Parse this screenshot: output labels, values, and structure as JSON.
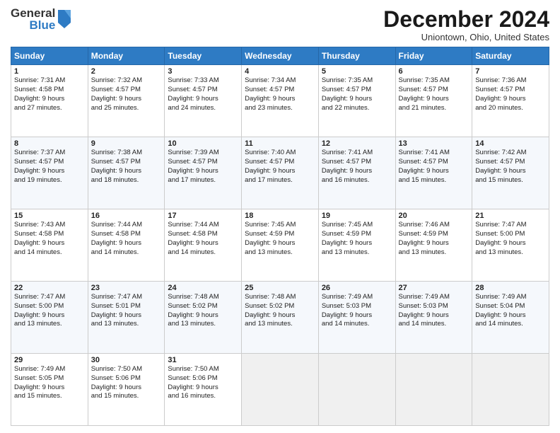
{
  "logo": {
    "general": "General",
    "blue": "Blue"
  },
  "title": "December 2024",
  "location": "Uniontown, Ohio, United States",
  "days_header": [
    "Sunday",
    "Monday",
    "Tuesday",
    "Wednesday",
    "Thursday",
    "Friday",
    "Saturday"
  ],
  "weeks": [
    [
      {
        "day": "1",
        "sunrise": "7:31 AM",
        "sunset": "4:58 PM",
        "daylight": "9 hours and 27 minutes."
      },
      {
        "day": "2",
        "sunrise": "7:32 AM",
        "sunset": "4:57 PM",
        "daylight": "9 hours and 25 minutes."
      },
      {
        "day": "3",
        "sunrise": "7:33 AM",
        "sunset": "4:57 PM",
        "daylight": "9 hours and 24 minutes."
      },
      {
        "day": "4",
        "sunrise": "7:34 AM",
        "sunset": "4:57 PM",
        "daylight": "9 hours and 23 minutes."
      },
      {
        "day": "5",
        "sunrise": "7:35 AM",
        "sunset": "4:57 PM",
        "daylight": "9 hours and 22 minutes."
      },
      {
        "day": "6",
        "sunrise": "7:35 AM",
        "sunset": "4:57 PM",
        "daylight": "9 hours and 21 minutes."
      },
      {
        "day": "7",
        "sunrise": "7:36 AM",
        "sunset": "4:57 PM",
        "daylight": "9 hours and 20 minutes."
      }
    ],
    [
      {
        "day": "8",
        "sunrise": "7:37 AM",
        "sunset": "4:57 PM",
        "daylight": "9 hours and 19 minutes."
      },
      {
        "day": "9",
        "sunrise": "7:38 AM",
        "sunset": "4:57 PM",
        "daylight": "9 hours and 18 minutes."
      },
      {
        "day": "10",
        "sunrise": "7:39 AM",
        "sunset": "4:57 PM",
        "daylight": "9 hours and 17 minutes."
      },
      {
        "day": "11",
        "sunrise": "7:40 AM",
        "sunset": "4:57 PM",
        "daylight": "9 hours and 17 minutes."
      },
      {
        "day": "12",
        "sunrise": "7:41 AM",
        "sunset": "4:57 PM",
        "daylight": "9 hours and 16 minutes."
      },
      {
        "day": "13",
        "sunrise": "7:41 AM",
        "sunset": "4:57 PM",
        "daylight": "9 hours and 15 minutes."
      },
      {
        "day": "14",
        "sunrise": "7:42 AM",
        "sunset": "4:57 PM",
        "daylight": "9 hours and 15 minutes."
      }
    ],
    [
      {
        "day": "15",
        "sunrise": "7:43 AM",
        "sunset": "4:58 PM",
        "daylight": "9 hours and 14 minutes."
      },
      {
        "day": "16",
        "sunrise": "7:44 AM",
        "sunset": "4:58 PM",
        "daylight": "9 hours and 14 minutes."
      },
      {
        "day": "17",
        "sunrise": "7:44 AM",
        "sunset": "4:58 PM",
        "daylight": "9 hours and 14 minutes."
      },
      {
        "day": "18",
        "sunrise": "7:45 AM",
        "sunset": "4:59 PM",
        "daylight": "9 hours and 13 minutes."
      },
      {
        "day": "19",
        "sunrise": "7:45 AM",
        "sunset": "4:59 PM",
        "daylight": "9 hours and 13 minutes."
      },
      {
        "day": "20",
        "sunrise": "7:46 AM",
        "sunset": "4:59 PM",
        "daylight": "9 hours and 13 minutes."
      },
      {
        "day": "21",
        "sunrise": "7:47 AM",
        "sunset": "5:00 PM",
        "daylight": "9 hours and 13 minutes."
      }
    ],
    [
      {
        "day": "22",
        "sunrise": "7:47 AM",
        "sunset": "5:00 PM",
        "daylight": "9 hours and 13 minutes."
      },
      {
        "day": "23",
        "sunrise": "7:47 AM",
        "sunset": "5:01 PM",
        "daylight": "9 hours and 13 minutes."
      },
      {
        "day": "24",
        "sunrise": "7:48 AM",
        "sunset": "5:02 PM",
        "daylight": "9 hours and 13 minutes."
      },
      {
        "day": "25",
        "sunrise": "7:48 AM",
        "sunset": "5:02 PM",
        "daylight": "9 hours and 13 minutes."
      },
      {
        "day": "26",
        "sunrise": "7:49 AM",
        "sunset": "5:03 PM",
        "daylight": "9 hours and 14 minutes."
      },
      {
        "day": "27",
        "sunrise": "7:49 AM",
        "sunset": "5:03 PM",
        "daylight": "9 hours and 14 minutes."
      },
      {
        "day": "28",
        "sunrise": "7:49 AM",
        "sunset": "5:04 PM",
        "daylight": "9 hours and 14 minutes."
      }
    ],
    [
      {
        "day": "29",
        "sunrise": "7:49 AM",
        "sunset": "5:05 PM",
        "daylight": "9 hours and 15 minutes."
      },
      {
        "day": "30",
        "sunrise": "7:50 AM",
        "sunset": "5:06 PM",
        "daylight": "9 hours and 15 minutes."
      },
      {
        "day": "31",
        "sunrise": "7:50 AM",
        "sunset": "5:06 PM",
        "daylight": "9 hours and 16 minutes."
      },
      null,
      null,
      null,
      null
    ]
  ],
  "labels": {
    "sunrise": "Sunrise:",
    "sunset": "Sunset:",
    "daylight": "Daylight:"
  }
}
